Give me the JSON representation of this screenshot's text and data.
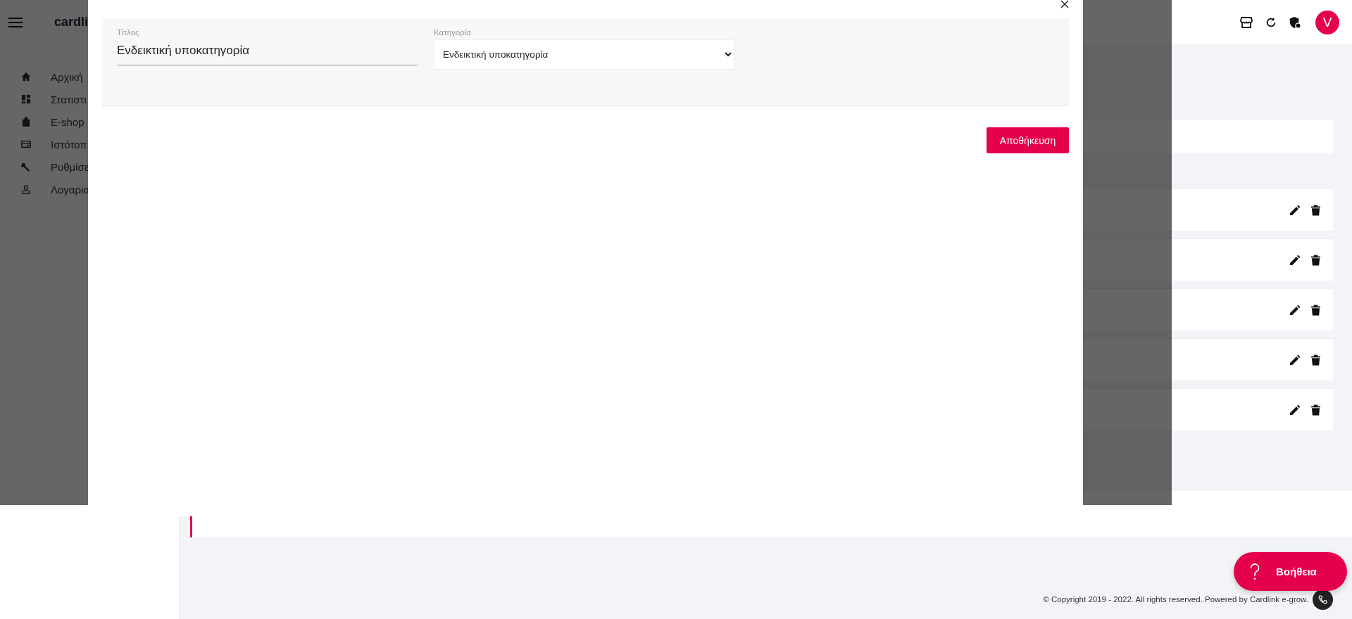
{
  "header": {
    "logo": "cardli",
    "avatar": "V"
  },
  "sidebar": {
    "items": [
      {
        "label": "Αρχική"
      },
      {
        "label": "Στατιστι"
      },
      {
        "label": "E-shop"
      },
      {
        "label": "Ιστότοπ"
      },
      {
        "label": "Ρυθμίσε"
      },
      {
        "label": "Λογαρια"
      }
    ]
  },
  "modal": {
    "title_field": {
      "label": "Τίτλος",
      "value": "Ενδεικτική υποκατηγορία"
    },
    "category_field": {
      "label": "Κατηγορία",
      "value": "Ενδεικτική υποκατηγορία"
    },
    "save_button": "Αποθήκευση"
  },
  "help_button": "Βοήθεια",
  "footer": {
    "copyright": "© Copyright 2019 - 2022. All rights reserved. Powered by Cardlink e-grow."
  }
}
